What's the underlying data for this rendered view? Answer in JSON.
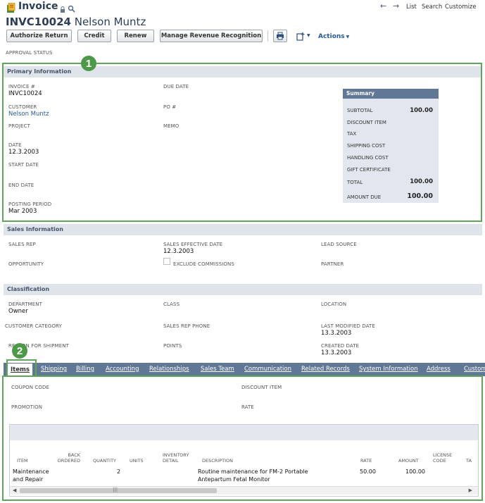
{
  "header": {
    "record_type": "Invoice",
    "title_number": "INVC10024",
    "title_name": "Nelson Muntz",
    "nav_list": "List",
    "nav_search": "Search",
    "nav_customize": "Customize"
  },
  "toolbar": {
    "authorize_return": "Authorize Return",
    "credit": "Credit",
    "renew": "Renew",
    "manage_revenue": "Manage Revenue Recognition",
    "actions": "Actions"
  },
  "approval_status_label": "APPROVAL STATUS",
  "badges": {
    "one": "1",
    "two": "2"
  },
  "primary": {
    "heading": "Primary Information",
    "invoice_label": "INVOICE #",
    "invoice_value": "INVC10024",
    "customer_label": "CUSTOMER",
    "customer_value": "Nelson Muntz",
    "project_label": "PROJECT",
    "date_label": "DATE",
    "date_value": "12.3.2003",
    "start_date_label": "START DATE",
    "end_date_label": "END DATE",
    "posting_label": "POSTING PERIOD",
    "posting_value": "Mar 2003",
    "due_date_label": "DUE DATE",
    "po_label": "PO #",
    "memo_label": "MEMO"
  },
  "summary": {
    "heading": "Summary",
    "subtotal_label": "SUBTOTAL",
    "subtotal_value": "100.00",
    "discount_label": "DISCOUNT ITEM",
    "tax_label": "TAX",
    "shipping_label": "SHIPPING COST",
    "handling_label": "HANDLING COST",
    "gift_label": "GIFT CERTIFICATE",
    "total_label": "TOTAL",
    "total_value": "100.00",
    "amount_due_label": "AMOUNT DUE",
    "amount_due_value": "100.00"
  },
  "sales": {
    "heading": "Sales Information",
    "sales_rep_label": "SALES REP",
    "opportunity_label": "OPPORTUNITY",
    "effective_date_label": "SALES EFFECTIVE DATE",
    "effective_date_value": "12.3.2003",
    "exclude_label": "EXCLUDE COMMISSIONS",
    "lead_source_label": "LEAD SOURCE",
    "partner_label": "PARTNER"
  },
  "classification": {
    "heading": "Classification",
    "department_label": "DEPARTMENT",
    "department_value": "Owner",
    "customer_category_label": "CUSTOMER CATEGORY",
    "reason_label": "REASON FOR SHIPMENT",
    "class_label": "CLASS",
    "rep_phone_label": "SALES REP PHONE",
    "points_label": "POINTS",
    "location_label": "LOCATION",
    "modified_label": "LAST MODIFIED DATE",
    "modified_value": "13.3.2003",
    "created_label": "CREATED DATE",
    "created_value": "13.3.2003"
  },
  "tabs": [
    "Items",
    "Shipping",
    "Billing",
    "Accounting",
    "Relationships",
    "Sales Team",
    "Communication",
    "Related Records",
    "System Information",
    "Address",
    "Custom"
  ],
  "items_tab": {
    "coupon_label": "COUPON CODE",
    "promotion_label": "PROMOTION",
    "discount_item_label": "DISCOUNT ITEM",
    "rate_label": "RATE",
    "columns": {
      "item": "ITEM",
      "back_ordered": "BACK ORDERED",
      "quantity": "QUANTITY",
      "units": "UNITS",
      "inventory_detail": "INVENTORY DETAIL",
      "description": "DESCRIPTION",
      "rate": "RATE",
      "amount": "AMOUNT",
      "license_code": "LICENSE CODE",
      "tax": "TA"
    },
    "row": {
      "item": "Maintenance and Repair",
      "quantity": "2",
      "description": "Routine maintenance for FM-2 Portable Antepartum Fetal Monitor",
      "rate": "50.00",
      "amount": "100.00"
    }
  },
  "colors": {
    "tabbar": "#607895",
    "section": "#dfe4eb",
    "annotation": "#5fa55a",
    "link": "#255a9a"
  },
  "icons": [
    "invoice-icon",
    "lock-icon",
    "search-icon",
    "back-arrow-icon",
    "forward-arrow-icon",
    "print-icon",
    "attach-icon",
    "caret-down-icon"
  ]
}
